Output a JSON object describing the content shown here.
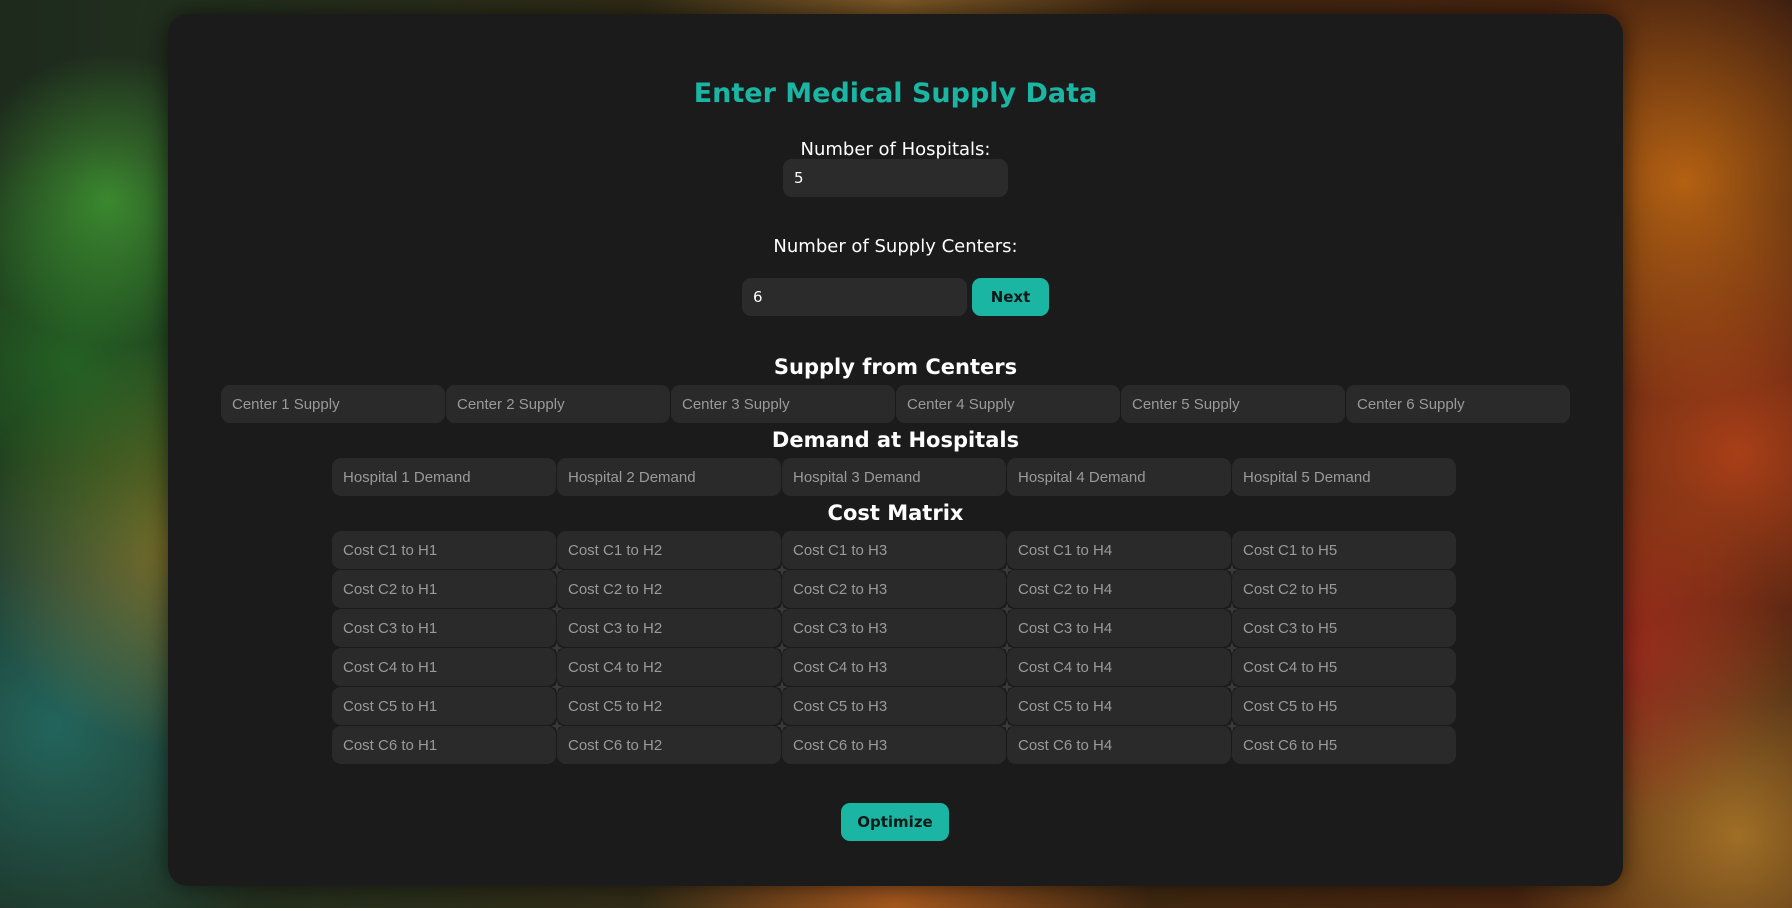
{
  "form": {
    "title": "Enter Medical Supply Data",
    "hospitals_label": "Number of Hospitals:",
    "hospitals_value": "5",
    "centers_label": "Number of Supply Centers:",
    "centers_value": "6",
    "next_label": "Next"
  },
  "supply": {
    "title": "Supply from Centers",
    "placeholders": [
      "Center 1 Supply",
      "Center 2 Supply",
      "Center 3 Supply",
      "Center 4 Supply",
      "Center 5 Supply",
      "Center 6 Supply"
    ]
  },
  "demand": {
    "title": "Demand at Hospitals",
    "placeholders": [
      "Hospital 1 Demand",
      "Hospital 2 Demand",
      "Hospital 3 Demand",
      "Hospital 4 Demand",
      "Hospital 5 Demand"
    ]
  },
  "cost": {
    "title": "Cost Matrix",
    "rows": [
      [
        "Cost C1 to H1",
        "Cost C1 to H2",
        "Cost C1 to H3",
        "Cost C1 to H4",
        "Cost C1 to H5"
      ],
      [
        "Cost C2 to H1",
        "Cost C2 to H2",
        "Cost C2 to H3",
        "Cost C2 to H4",
        "Cost C2 to H5"
      ],
      [
        "Cost C3 to H1",
        "Cost C3 to H2",
        "Cost C3 to H3",
        "Cost C3 to H4",
        "Cost C3 to H5"
      ],
      [
        "Cost C4 to H1",
        "Cost C4 to H2",
        "Cost C4 to H3",
        "Cost C4 to H4",
        "Cost C4 to H5"
      ],
      [
        "Cost C5 to H1",
        "Cost C5 to H2",
        "Cost C5 to H3",
        "Cost C5 to H4",
        "Cost C5 to H5"
      ],
      [
        "Cost C6 to H1",
        "Cost C6 to H2",
        "Cost C6 to H3",
        "Cost C6 to H4",
        "Cost C6 to H5"
      ]
    ]
  },
  "actions": {
    "optimize_label": "Optimize"
  },
  "colors": {
    "accent": "#1ab5a3",
    "panel": "#1b1b1b",
    "field": "#2a2a2a"
  }
}
